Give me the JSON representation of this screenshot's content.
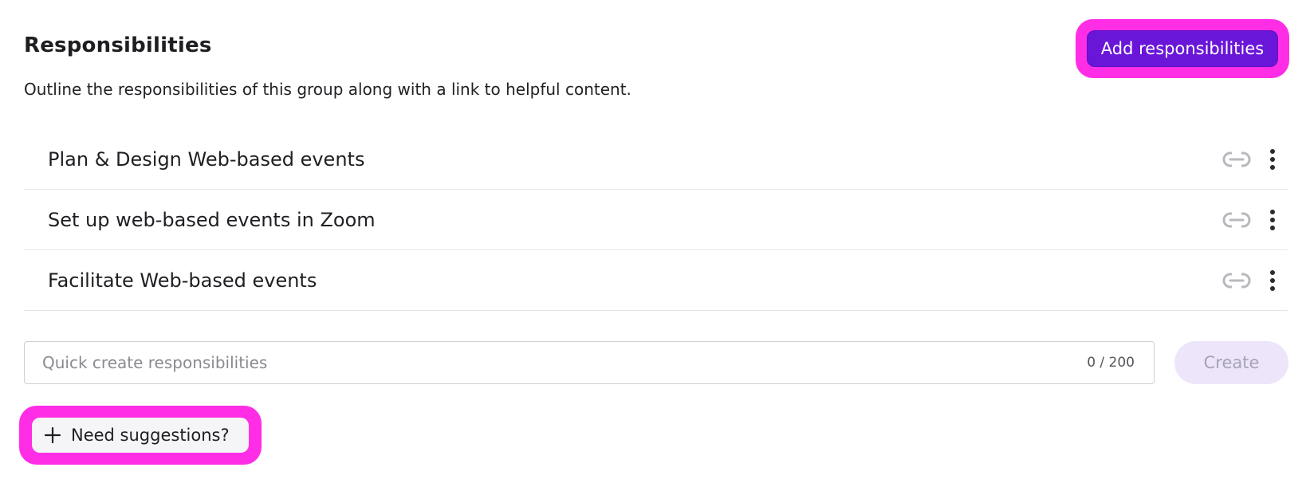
{
  "header": {
    "title": "Responsibilities",
    "description": "Outline the responsibilities of this group along with a link to helpful content.",
    "add_button_label": "Add responsibilities"
  },
  "responsibilities": [
    {
      "label": "Plan & Design Web-based events",
      "link_icon": "link-icon",
      "menu_icon": "more-vertical-icon"
    },
    {
      "label": "Set up web-based events in Zoom",
      "link_icon": "link-icon",
      "menu_icon": "more-vertical-icon"
    },
    {
      "label": "Facilitate Web-based events",
      "link_icon": "link-icon",
      "menu_icon": "more-vertical-icon"
    }
  ],
  "quick_create": {
    "placeholder": "Quick create responsibilities",
    "value": "",
    "counter": "0 / 200",
    "create_label": "Create"
  },
  "suggestions": {
    "label": "Need suggestions?",
    "icon": "plus-icon"
  },
  "colors": {
    "accent": "#6a16d9",
    "highlight": "#ff2ee6",
    "create_disabled_bg": "#ede6fb",
    "icon_gray": "#b8b8be"
  }
}
